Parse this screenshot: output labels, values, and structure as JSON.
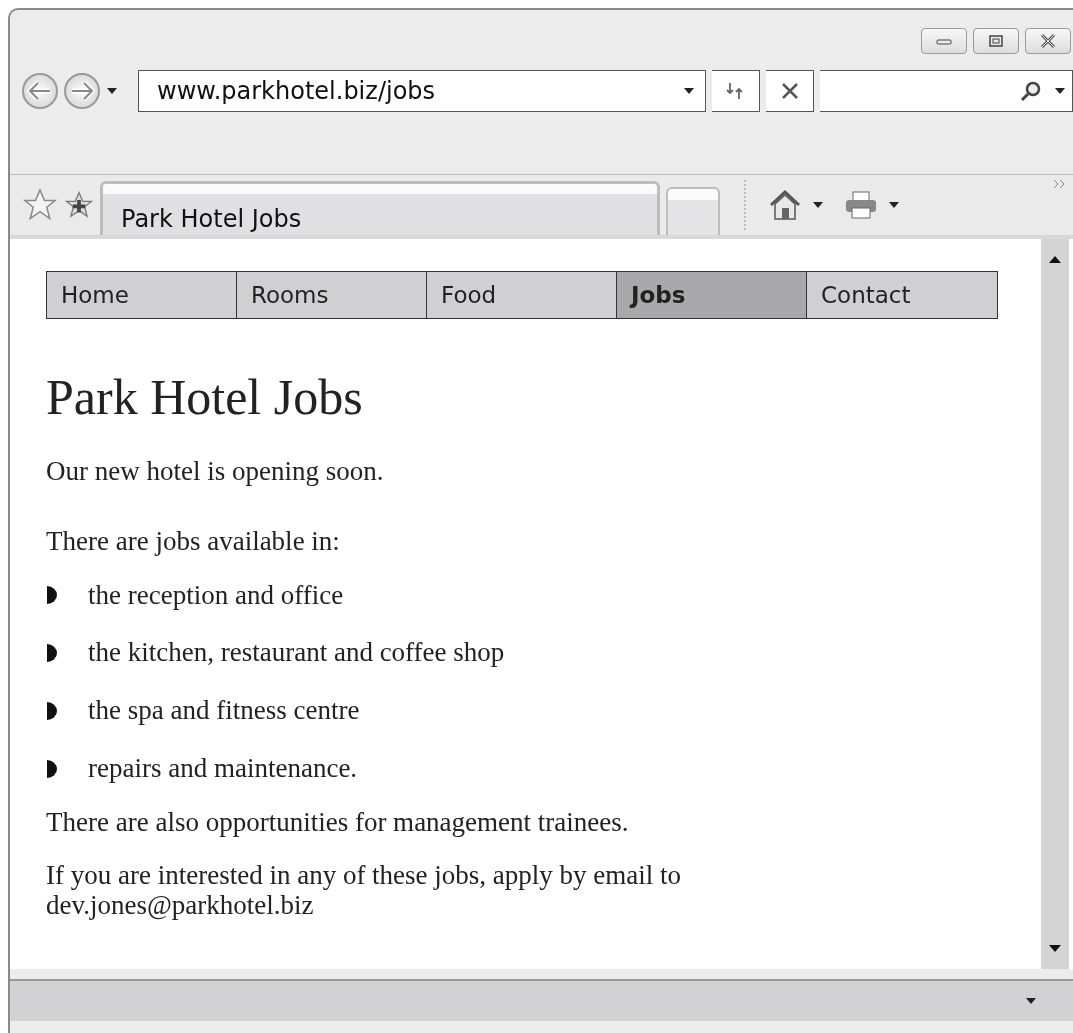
{
  "browser": {
    "address": "www.parkhotel.biz/jobs",
    "tab_title": "Park Hotel Jobs"
  },
  "nav": [
    {
      "label": "Home",
      "selected": false
    },
    {
      "label": "Rooms",
      "selected": false
    },
    {
      "label": "Food",
      "selected": false
    },
    {
      "label": "Jobs",
      "selected": true
    },
    {
      "label": "Contact",
      "selected": false
    }
  ],
  "page": {
    "heading": "Park Hotel Jobs",
    "intro": "Our new hotel is opening soon.",
    "list_intro": "There are jobs available in:",
    "items": [
      "the reception and office",
      "the kitchen, restaurant and coffee shop",
      "the spa and fitness centre",
      "repairs and maintenance."
    ],
    "trainees": "There are also opportunities for management trainees.",
    "apply": "If you are interested in any of these jobs, apply by email to",
    "email": "dev.jones@parkhotel.biz"
  }
}
